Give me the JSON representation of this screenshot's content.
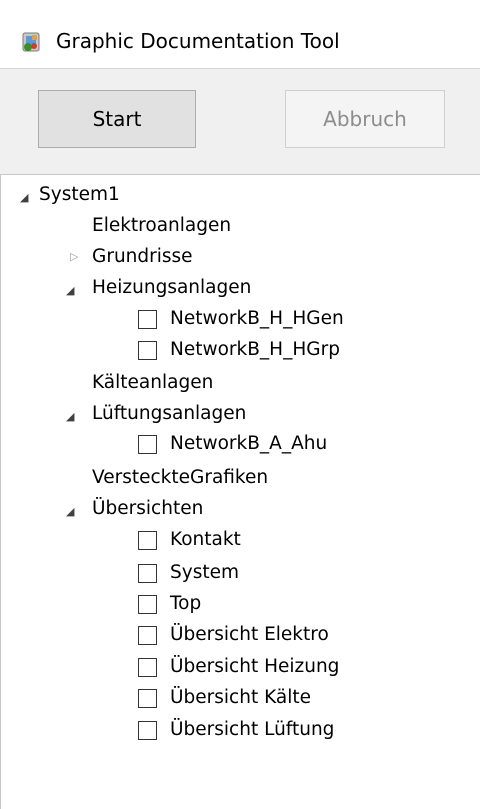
{
  "window": {
    "title": "Graphic Documentation Tool",
    "icon": "app-graphic-doc-icon"
  },
  "toolbar": {
    "start_label": "Start",
    "cancel_label": "Abbruch"
  },
  "tree": {
    "root": "System1",
    "items": {
      "elektroanlagen": "Elektroanlagen",
      "grundrisse": "Grundrisse",
      "heizungsanlagen": "Heizungsanlagen",
      "networkb_h_hgen": "NetworkB_H_HGen",
      "networkb_h_hgrp": "NetworkB_H_HGrp",
      "kaelteanlagen": "Kälteanlagen",
      "lueftungsanlagen": "Lüftungsanlagen",
      "networkb_a_ahu": "NetworkB_A_Ahu",
      "versteckte_grafiken": "VersteckteGrafiken",
      "uebersichten": "Übersichten",
      "kontakt": "Kontakt",
      "system": "System",
      "top": "Top",
      "uebersicht_elektro": "Übersicht Elektro",
      "uebersicht_heizung": "Übersicht Heizung",
      "uebersicht_kaelte": "Übersicht Kälte",
      "uebersicht_lueftung": "Übersicht Lüftung"
    }
  },
  "colors": {
    "window_bg": "#f0f0f0",
    "titlebar_bg": "#ffffff",
    "button_bg": "#e1e1e1",
    "disabled_text": "#8c8c8c",
    "tree_bg": "#ffffff"
  }
}
